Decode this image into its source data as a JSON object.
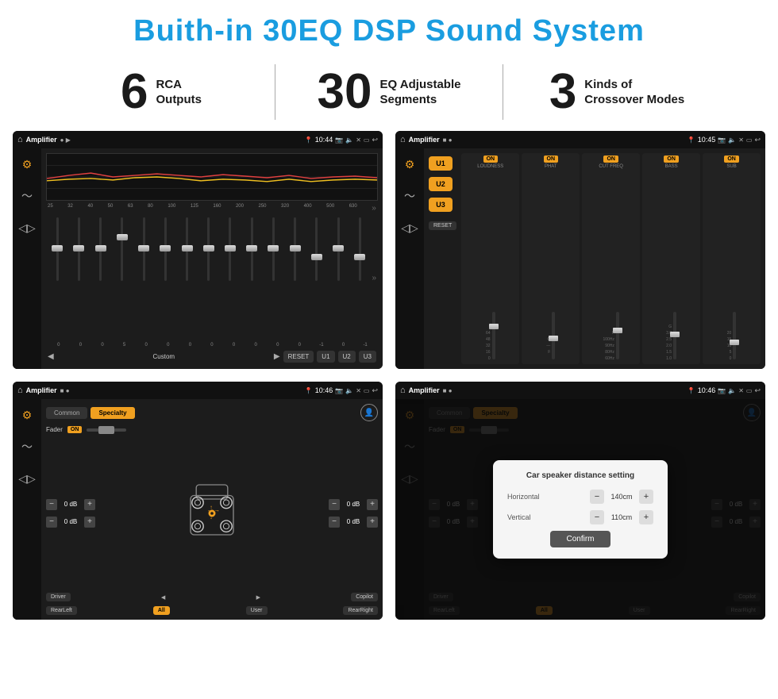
{
  "page": {
    "title": "Buith-in 30EQ DSP Sound System",
    "stats": [
      {
        "number": "6",
        "text": "RCA\nOutputs"
      },
      {
        "number": "30",
        "text": "EQ Adjustable\nSegments"
      },
      {
        "number": "3",
        "text": "Kinds of\nCrossover Modes"
      }
    ]
  },
  "screen1": {
    "status": {
      "time": "10:44",
      "title": "Amplifier"
    },
    "freqs": [
      "25",
      "32",
      "40",
      "50",
      "63",
      "80",
      "100",
      "125",
      "160",
      "200",
      "250",
      "320",
      "400",
      "500",
      "630"
    ],
    "vals": [
      "0",
      "0",
      "0",
      "5",
      "0",
      "0",
      "0",
      "0",
      "0",
      "0",
      "0",
      "0",
      "-1",
      "0",
      "-1"
    ],
    "thumbPositions": [
      50,
      50,
      50,
      30,
      50,
      50,
      50,
      50,
      50,
      50,
      50,
      50,
      65,
      50,
      65
    ],
    "bottomBtns": [
      "Custom",
      "RESET",
      "U1",
      "U2",
      "U3"
    ]
  },
  "screen2": {
    "status": {
      "time": "10:45",
      "title": "Amplifier"
    },
    "uBtns": [
      "U1",
      "U2",
      "U3"
    ],
    "channels": [
      {
        "on": "ON",
        "label": "LOUDNESS"
      },
      {
        "on": "ON",
        "label": "PHAT"
      },
      {
        "on": "ON",
        "label": "CUT FREQ"
      },
      {
        "on": "ON",
        "label": "BASS"
      },
      {
        "on": "ON",
        "label": "SUB"
      }
    ],
    "resetLabel": "RESET"
  },
  "screen3": {
    "status": {
      "time": "10:46",
      "title": "Amplifier"
    },
    "tabs": [
      "Common",
      "Specialty"
    ],
    "activeTab": "Specialty",
    "faderLabel": "Fader",
    "onBadge": "ON",
    "dbValues": [
      "0 dB",
      "0 dB",
      "0 dB",
      "0 dB"
    ],
    "bottomBtns": [
      "Driver",
      "Copilot",
      "RearLeft",
      "All",
      "User",
      "RearRight"
    ]
  },
  "screen4": {
    "status": {
      "time": "10:46",
      "title": "Amplifier"
    },
    "tabs": [
      "Common",
      "Specialty"
    ],
    "activeTab": "Specialty",
    "onBadge": "ON",
    "dialog": {
      "title": "Car speaker distance setting",
      "horizontal": {
        "label": "Horizontal",
        "value": "140cm"
      },
      "vertical": {
        "label": "Vertical",
        "value": "110cm"
      },
      "confirmBtn": "Confirm"
    },
    "dbValues": [
      "0 dB",
      "0 dB"
    ],
    "bottomBtns": [
      "Driver",
      "Copilot",
      "RearLeft",
      "All",
      "User",
      "RearRight"
    ]
  }
}
